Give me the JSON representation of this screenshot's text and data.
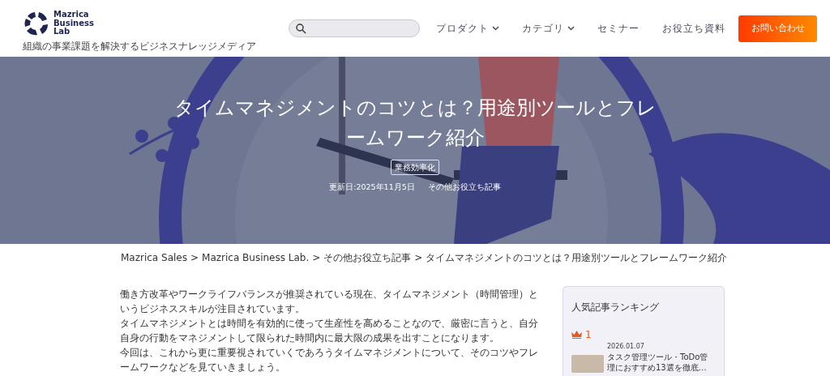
{
  "header": {
    "logo_text": [
      "Mazrica",
      "Business",
      "Lab"
    ],
    "tagline": "組織の事業課題を解決するビジネスナレッジメディア",
    "nav": [
      {
        "label": "プロダクト",
        "dropdown": true
      },
      {
        "label": "カテゴリ",
        "dropdown": true
      },
      {
        "label": "セミナー",
        "dropdown": false
      },
      {
        "label": "お役立ち資料",
        "dropdown": false
      }
    ],
    "cta": "お問い合わせ"
  },
  "hero": {
    "title": "タイムマネジメントのコツとは？用途別ツールとフレームワーク紹介",
    "tag": "業務効率化",
    "updated": "更新日:2025年11月5日",
    "category": "その他お役立ち記事"
  },
  "breadcrumb": {
    "separator": ">",
    "items": [
      "Mazrica Sales",
      "Mazrica Business Lab.",
      "その他お役立ち記事",
      "タイムマネジメントのコツとは？用途別ツールとフレームワーク紹介"
    ]
  },
  "article": {
    "paragraphs": [
      "働き方改革やワークライフバランスが推奨されている現在、タイムマネジメント（時間管理）というビジネススキルが注目されています。",
      "タイムマネジメントとは時間を有効的に使って生産性を高めることなので、厳密に言うと、自分自身の行動をマネジメントして限られた時間内に最大限の成果を出すことになります。",
      "今回は、これから更に重要視されていくであろうタイムマネジメントについて、そのコツやフレームワークなどを見ていきましょう。"
    ]
  },
  "sidebar": {
    "title": "人気記事ランキング",
    "ranking": [
      {
        "rank": "1",
        "date": "2026.01.07",
        "title": "タスク管理ツール・ToDo管理におすすめ13選を徹底…"
      }
    ]
  }
}
